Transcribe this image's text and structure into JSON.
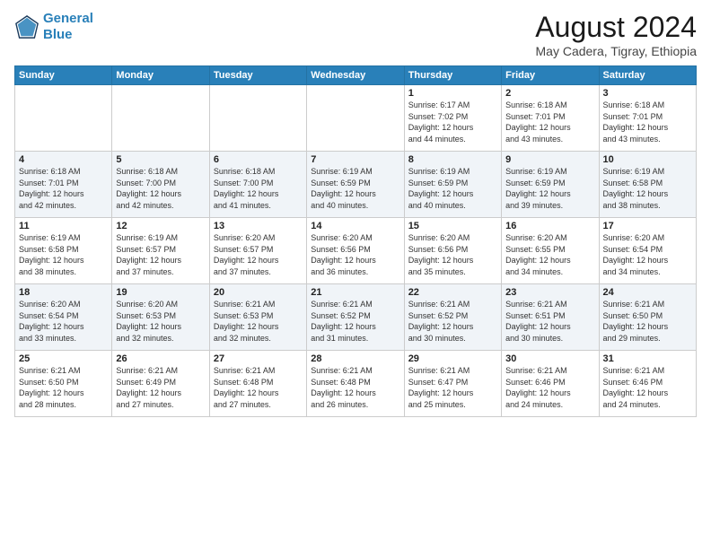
{
  "logo": {
    "line1": "General",
    "line2": "Blue"
  },
  "title": "August 2024",
  "subtitle": "May Cadera, Tigray, Ethiopia",
  "days_of_week": [
    "Sunday",
    "Monday",
    "Tuesday",
    "Wednesday",
    "Thursday",
    "Friday",
    "Saturday"
  ],
  "weeks": [
    [
      {
        "day": "",
        "info": ""
      },
      {
        "day": "",
        "info": ""
      },
      {
        "day": "",
        "info": ""
      },
      {
        "day": "",
        "info": ""
      },
      {
        "day": "1",
        "info": "Sunrise: 6:17 AM\nSunset: 7:02 PM\nDaylight: 12 hours\nand 44 minutes."
      },
      {
        "day": "2",
        "info": "Sunrise: 6:18 AM\nSunset: 7:01 PM\nDaylight: 12 hours\nand 43 minutes."
      },
      {
        "day": "3",
        "info": "Sunrise: 6:18 AM\nSunset: 7:01 PM\nDaylight: 12 hours\nand 43 minutes."
      }
    ],
    [
      {
        "day": "4",
        "info": "Sunrise: 6:18 AM\nSunset: 7:01 PM\nDaylight: 12 hours\nand 42 minutes."
      },
      {
        "day": "5",
        "info": "Sunrise: 6:18 AM\nSunset: 7:00 PM\nDaylight: 12 hours\nand 42 minutes."
      },
      {
        "day": "6",
        "info": "Sunrise: 6:18 AM\nSunset: 7:00 PM\nDaylight: 12 hours\nand 41 minutes."
      },
      {
        "day": "7",
        "info": "Sunrise: 6:19 AM\nSunset: 6:59 PM\nDaylight: 12 hours\nand 40 minutes."
      },
      {
        "day": "8",
        "info": "Sunrise: 6:19 AM\nSunset: 6:59 PM\nDaylight: 12 hours\nand 40 minutes."
      },
      {
        "day": "9",
        "info": "Sunrise: 6:19 AM\nSunset: 6:59 PM\nDaylight: 12 hours\nand 39 minutes."
      },
      {
        "day": "10",
        "info": "Sunrise: 6:19 AM\nSunset: 6:58 PM\nDaylight: 12 hours\nand 38 minutes."
      }
    ],
    [
      {
        "day": "11",
        "info": "Sunrise: 6:19 AM\nSunset: 6:58 PM\nDaylight: 12 hours\nand 38 minutes."
      },
      {
        "day": "12",
        "info": "Sunrise: 6:19 AM\nSunset: 6:57 PM\nDaylight: 12 hours\nand 37 minutes."
      },
      {
        "day": "13",
        "info": "Sunrise: 6:20 AM\nSunset: 6:57 PM\nDaylight: 12 hours\nand 37 minutes."
      },
      {
        "day": "14",
        "info": "Sunrise: 6:20 AM\nSunset: 6:56 PM\nDaylight: 12 hours\nand 36 minutes."
      },
      {
        "day": "15",
        "info": "Sunrise: 6:20 AM\nSunset: 6:56 PM\nDaylight: 12 hours\nand 35 minutes."
      },
      {
        "day": "16",
        "info": "Sunrise: 6:20 AM\nSunset: 6:55 PM\nDaylight: 12 hours\nand 34 minutes."
      },
      {
        "day": "17",
        "info": "Sunrise: 6:20 AM\nSunset: 6:54 PM\nDaylight: 12 hours\nand 34 minutes."
      }
    ],
    [
      {
        "day": "18",
        "info": "Sunrise: 6:20 AM\nSunset: 6:54 PM\nDaylight: 12 hours\nand 33 minutes."
      },
      {
        "day": "19",
        "info": "Sunrise: 6:20 AM\nSunset: 6:53 PM\nDaylight: 12 hours\nand 32 minutes."
      },
      {
        "day": "20",
        "info": "Sunrise: 6:21 AM\nSunset: 6:53 PM\nDaylight: 12 hours\nand 32 minutes."
      },
      {
        "day": "21",
        "info": "Sunrise: 6:21 AM\nSunset: 6:52 PM\nDaylight: 12 hours\nand 31 minutes."
      },
      {
        "day": "22",
        "info": "Sunrise: 6:21 AM\nSunset: 6:52 PM\nDaylight: 12 hours\nand 30 minutes."
      },
      {
        "day": "23",
        "info": "Sunrise: 6:21 AM\nSunset: 6:51 PM\nDaylight: 12 hours\nand 30 minutes."
      },
      {
        "day": "24",
        "info": "Sunrise: 6:21 AM\nSunset: 6:50 PM\nDaylight: 12 hours\nand 29 minutes."
      }
    ],
    [
      {
        "day": "25",
        "info": "Sunrise: 6:21 AM\nSunset: 6:50 PM\nDaylight: 12 hours\nand 28 minutes."
      },
      {
        "day": "26",
        "info": "Sunrise: 6:21 AM\nSunset: 6:49 PM\nDaylight: 12 hours\nand 27 minutes."
      },
      {
        "day": "27",
        "info": "Sunrise: 6:21 AM\nSunset: 6:48 PM\nDaylight: 12 hours\nand 27 minutes."
      },
      {
        "day": "28",
        "info": "Sunrise: 6:21 AM\nSunset: 6:48 PM\nDaylight: 12 hours\nand 26 minutes."
      },
      {
        "day": "29",
        "info": "Sunrise: 6:21 AM\nSunset: 6:47 PM\nDaylight: 12 hours\nand 25 minutes."
      },
      {
        "day": "30",
        "info": "Sunrise: 6:21 AM\nSunset: 6:46 PM\nDaylight: 12 hours\nand 24 minutes."
      },
      {
        "day": "31",
        "info": "Sunrise: 6:21 AM\nSunset: 6:46 PM\nDaylight: 12 hours\nand 24 minutes."
      }
    ]
  ]
}
